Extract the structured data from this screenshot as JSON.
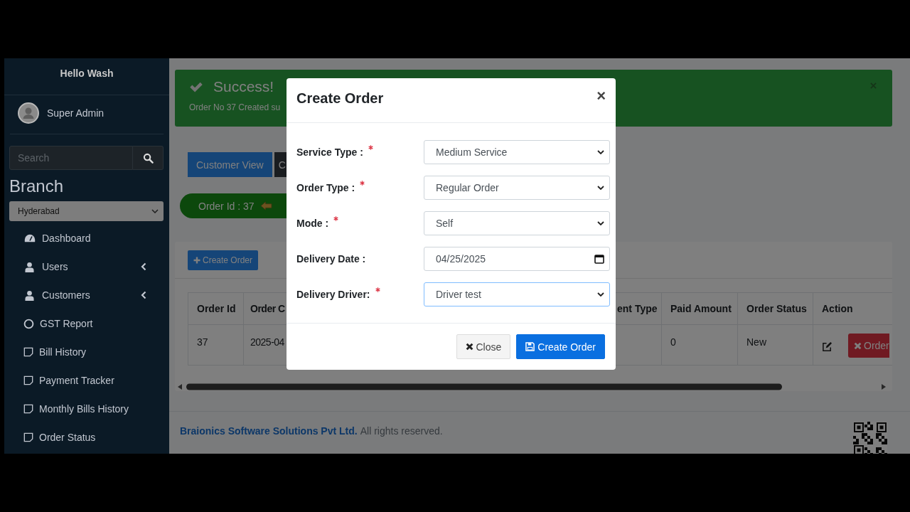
{
  "sidebar": {
    "brand": "Hello Wash",
    "user": {
      "name": "Super Admin"
    },
    "search": {
      "placeholder": "Search"
    },
    "branch": {
      "heading": "Branch",
      "value": "Hyderabad"
    },
    "items": [
      {
        "label": "Dashboard",
        "expandable": false
      },
      {
        "label": "Users",
        "expandable": true
      },
      {
        "label": "Customers",
        "expandable": true
      },
      {
        "label": "GST Report",
        "expandable": false
      },
      {
        "label": "Bill History",
        "expandable": false
      },
      {
        "label": "Payment Tracker",
        "expandable": false
      },
      {
        "label": "Monthly Bills History",
        "expandable": false
      },
      {
        "label": "Order Status",
        "expandable": false
      }
    ]
  },
  "alert": {
    "title": "Success!",
    "message": "Order No 37 Created su"
  },
  "tabs": [
    {
      "label": "Customer View",
      "selected": true
    },
    {
      "label": "C",
      "selected": false
    }
  ],
  "order_badge": {
    "label": "Order Id : 37"
  },
  "card": {
    "create_button": "Create Order",
    "table": {
      "columns": [
        "Order Id",
        "Order C",
        "ent Type",
        "Paid Amount",
        "Order Status",
        "Action"
      ],
      "rows": [
        {
          "order_id": "37",
          "column_2": "2025-04",
          "paid_amount": "0",
          "order_status": "New",
          "action_button": "Order"
        }
      ]
    }
  },
  "footer": {
    "company": "Braionics Software Solutions Pvt Ltd.",
    "text": "All rights reserved."
  },
  "modal": {
    "title": "Create Order",
    "close": "×",
    "fields": [
      {
        "label": "Service Type :",
        "required": true,
        "kind": "select",
        "value": "Medium Service",
        "focused": false
      },
      {
        "label": "Order Type :",
        "required": true,
        "kind": "select",
        "value": "Regular Order",
        "focused": false
      },
      {
        "label": "Mode :",
        "required": true,
        "kind": "select",
        "value": "Self",
        "focused": false
      },
      {
        "label": "Delivery Date :",
        "required": false,
        "kind": "date",
        "value": "04/25/2025",
        "focused": false
      },
      {
        "label": "Delivery Driver:",
        "required": true,
        "kind": "select",
        "value": "Driver test",
        "focused": true
      }
    ],
    "buttons": [
      {
        "label": "Close",
        "kind": "secondary"
      },
      {
        "label": "Create Order",
        "kind": "primary"
      }
    ]
  }
}
